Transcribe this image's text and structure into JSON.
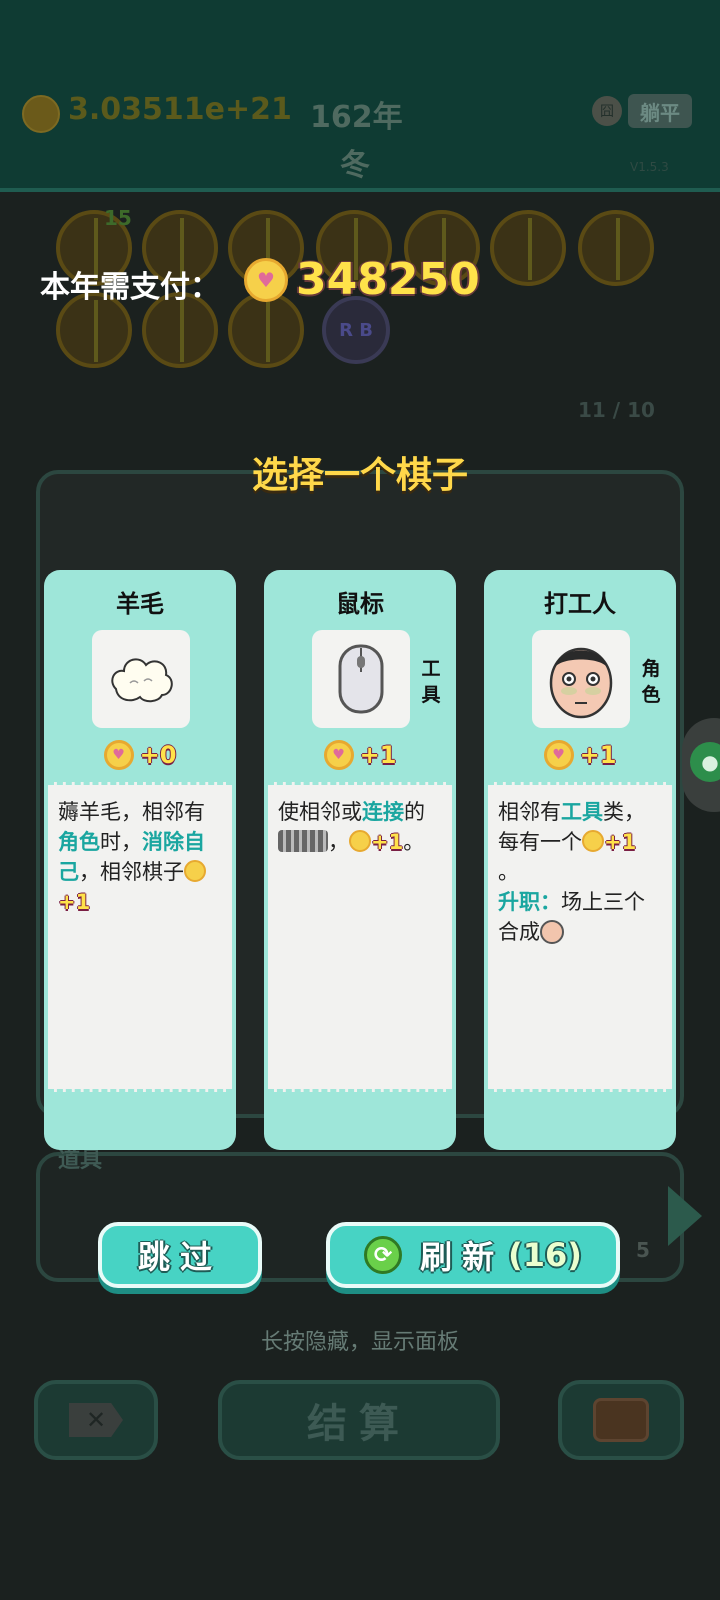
{
  "background": {
    "money": "3.03511e+21",
    "year": "162年",
    "season": "冬",
    "flat_button": "躺平",
    "flat_icon": "囧",
    "corner_text": "V1.5.3",
    "piece_count_badge": "15",
    "rgb_piece_label": "R B",
    "board_count": "11 / 10",
    "tray_label": "道具",
    "tray_count": "5",
    "hint": "长按隐藏，显示面板",
    "settle_button": "结算",
    "delete_icon": "x-icon"
  },
  "overlay": {
    "pay_label": "本年需支付：",
    "pay_amount": "348250",
    "title": "选择一个棋子"
  },
  "cards": [
    {
      "name": "羊毛",
      "icon": "wool-icon",
      "tag": "",
      "gain": "+0",
      "desc": {
        "t1": "薅羊毛，相邻有",
        "h1": "角色",
        "t2": "时，",
        "h2": "消除自己",
        "t3": "，相邻棋子",
        "plus": "+1"
      }
    },
    {
      "name": "鼠标",
      "icon": "mouse-icon",
      "tag": "工具",
      "gain": "+1",
      "desc": {
        "t1": "使相邻或",
        "h1": "连接",
        "t2": "的",
        "t3": "，",
        "plus": "+1",
        "t4": "。"
      }
    },
    {
      "name": "打工人",
      "icon": "worker-face-icon",
      "tag": "角色",
      "gain": "+1",
      "desc": {
        "t1": "相邻有",
        "h1": "工具",
        "t2": "类，每有一个",
        "plus": "+1",
        "t3": "。",
        "h2": "升职：",
        "t4": "场上三个合成"
      }
    }
  ],
  "buttons": {
    "skip": "跳过",
    "refresh": "刷新",
    "refresh_count": "(16)"
  },
  "colors": {
    "accent_teal": "#47d3c4",
    "card_bg": "#9ee6d9",
    "gold": "#ffe24a",
    "highlight": "#1aa6a0"
  }
}
